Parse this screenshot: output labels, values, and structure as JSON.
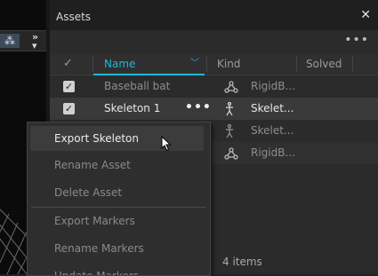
{
  "panel": {
    "title": "Assets",
    "close_icon": "close-icon",
    "more_icon": "more-horizontal-icon"
  },
  "columns": {
    "check": "✓",
    "name": "Name",
    "kind": "Kind",
    "solved": "Solved"
  },
  "rows": [
    {
      "name": "Baseball bat",
      "kind": "RigidB...",
      "kind_icon": "rigid-body-icon",
      "checked": true,
      "selected": false
    },
    {
      "name": "Skeleton 1",
      "kind": "Skelet...",
      "kind_icon": "skeleton-icon",
      "checked": true,
      "selected": true
    },
    {
      "name": "",
      "kind": "Skelet...",
      "kind_icon": "skeleton-icon",
      "checked": false,
      "selected": false
    },
    {
      "name": "",
      "kind": "RigidB...",
      "kind_icon": "rigid-body-icon",
      "checked": false,
      "selected": false
    }
  ],
  "footer": {
    "count": "4 items"
  },
  "context_menu": {
    "items": [
      {
        "label": "Export Skeleton",
        "active": true
      },
      {
        "label": "Rename Asset",
        "active": false
      },
      {
        "label": "Delete Asset",
        "active": false
      },
      {
        "label": "Export Markers",
        "active": false
      },
      {
        "label": "Rename Markers",
        "active": false
      },
      {
        "label": "Update Markers",
        "active": false
      }
    ]
  },
  "colors": {
    "accent": "#1fb8d6",
    "panel_bg": "#2b2b2b",
    "selected_row": "#3a3a3a"
  }
}
